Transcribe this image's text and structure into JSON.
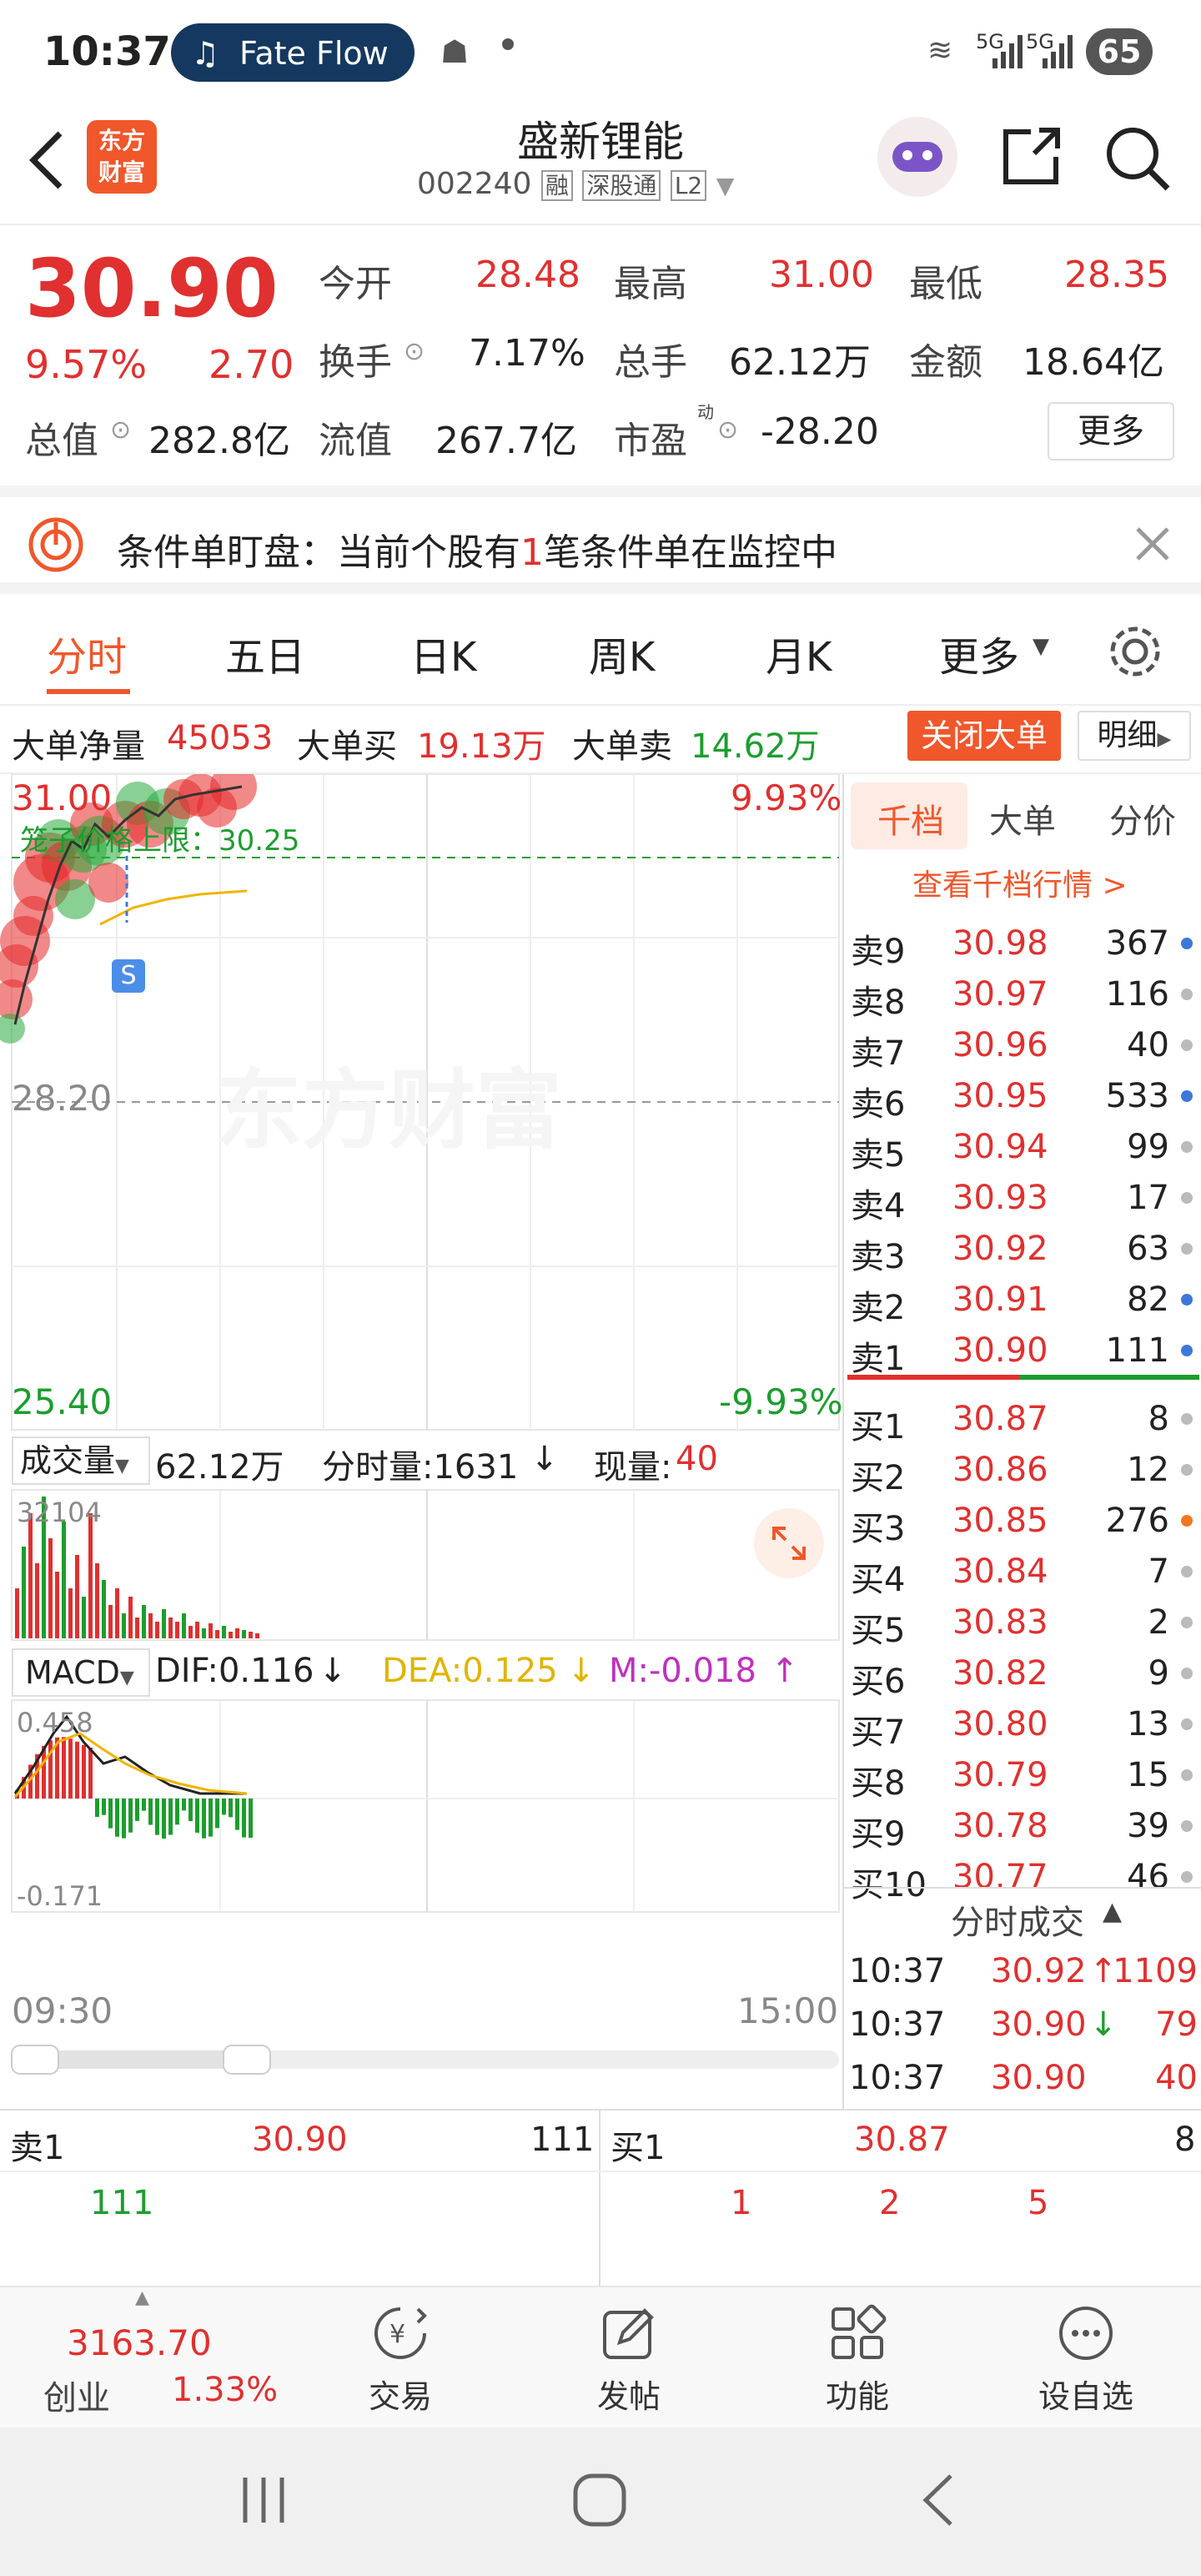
{
  "statusbar": {
    "time": "10:37",
    "pill_label": "Fate Flow",
    "battery": "65",
    "net1": "5G",
    "net2": "5G"
  },
  "header": {
    "logo_line1": "东方",
    "logo_line2": "财富",
    "stock_name": "盛新锂能",
    "stock_code": "002240",
    "tag_rong": "融",
    "tag_sgt": "深股通",
    "tag_l2": "L2"
  },
  "quote": {
    "price": "30.90",
    "pct": "9.57%",
    "change": "2.70",
    "open_label": "今开",
    "open": "28.48",
    "high_label": "最高",
    "high": "31.00",
    "low_label": "最低",
    "low": "28.35",
    "turnover_label": "换手",
    "turnover": "7.17%",
    "volume_label": "总手",
    "volume": "62.12万",
    "amount_label": "金额",
    "amount": "18.64亿",
    "mktcap_label": "总值",
    "mktcap": "282.8亿",
    "float_label": "流值",
    "float": "267.7亿",
    "pe_label": "市盈",
    "pe_sup": "动",
    "pe": "-28.20",
    "more_label": "更多"
  },
  "alert": {
    "text_pre": "条件单盯盘：当前个股有",
    "count": "1",
    "text_post": "笔条件单在监控中"
  },
  "tabs": [
    {
      "label": "分时"
    },
    {
      "label": "五日"
    },
    {
      "label": "日K"
    },
    {
      "label": "周K"
    },
    {
      "label": "月K"
    },
    {
      "label": "更多"
    }
  ],
  "dadan": {
    "net_label": "大单净量",
    "net": "45053",
    "buy_label": "大单买",
    "buy": "19.13万",
    "sell_label": "大单卖",
    "sell": "14.62万",
    "close_btn": "关闭大单",
    "detail_btn": "明细"
  },
  "chart": {
    "high_price": "31.00",
    "high_pct": "9.93%",
    "mid_price": "28.20",
    "low_price": "25.40",
    "low_pct": "-9.93%",
    "cage_label": "笼子价格上限：30.25",
    "watermark": "东方财富",
    "s_marker": "S",
    "vol_label": "成交量",
    "vol_total": "62.12万",
    "vol_min_label": "分时量:1631",
    "vol_now_label": "现量:",
    "vol_now": "40",
    "vol_max": "32104",
    "macd_label": "MACD",
    "dif": "DIF:0.116",
    "dea": "DEA:0.125",
    "m": "M:-0.018",
    "macd_max": "0.458",
    "macd_min": "-0.171",
    "time_start": "09:30",
    "time_end": "15:00"
  },
  "orderbook": {
    "tabs": [
      {
        "label": "千档"
      },
      {
        "label": "大单"
      },
      {
        "label": "分价"
      }
    ],
    "link": "查看千档行情 >",
    "sell": [
      {
        "label": "卖9",
        "price": "30.98",
        "vol": "367",
        "dot": "#3b78d8"
      },
      {
        "label": "卖8",
        "price": "30.97",
        "vol": "116",
        "dot": "#bbbbbb"
      },
      {
        "label": "卖7",
        "price": "30.96",
        "vol": "40",
        "dot": "#bbbbbb"
      },
      {
        "label": "卖6",
        "price": "30.95",
        "vol": "533",
        "dot": "#3b78d8"
      },
      {
        "label": "卖5",
        "price": "30.94",
        "vol": "99",
        "dot": "#bbbbbb"
      },
      {
        "label": "卖4",
        "price": "30.93",
        "vol": "17",
        "dot": "#bbbbbb"
      },
      {
        "label": "卖3",
        "price": "30.92",
        "vol": "63",
        "dot": "#bbbbbb"
      },
      {
        "label": "卖2",
        "price": "30.91",
        "vol": "82",
        "dot": "#3b78d8"
      },
      {
        "label": "卖1",
        "price": "30.90",
        "vol": "111",
        "dot": "#3b78d8"
      }
    ],
    "buy": [
      {
        "label": "买1",
        "price": "30.87",
        "vol": "8",
        "dot": "#bbbbbb"
      },
      {
        "label": "买2",
        "price": "30.86",
        "vol": "12",
        "dot": "#bbbbbb"
      },
      {
        "label": "买3",
        "price": "30.85",
        "vol": "276",
        "dot": "#f07820"
      },
      {
        "label": "买4",
        "price": "30.84",
        "vol": "7",
        "dot": "#bbbbbb"
      },
      {
        "label": "买5",
        "price": "30.83",
        "vol": "2",
        "dot": "#bbbbbb"
      },
      {
        "label": "买6",
        "price": "30.82",
        "vol": "9",
        "dot": "#bbbbbb"
      },
      {
        "label": "买7",
        "price": "30.80",
        "vol": "13",
        "dot": "#bbbbbb"
      },
      {
        "label": "买8",
        "price": "30.79",
        "vol": "15",
        "dot": "#bbbbbb"
      },
      {
        "label": "买9",
        "price": "30.78",
        "vol": "39",
        "dot": "#bbbbbb"
      },
      {
        "label": "买10",
        "price": "30.77",
        "vol": "46",
        "dot": "#bbbbbb"
      }
    ],
    "ticks_title": "分时成交",
    "ticks": [
      {
        "time": "10:37",
        "price": "30.92",
        "arrow": "↑",
        "vol": "1109"
      },
      {
        "time": "10:37",
        "price": "30.90",
        "arrow": "↓",
        "vol": "79"
      },
      {
        "time": "10:37",
        "price": "30.90",
        "arrow": "",
        "vol": "40"
      }
    ]
  },
  "bottom": {
    "sell_label": "卖1",
    "sell_price": "30.90",
    "sell_vol": "111",
    "buy_label": "买1",
    "buy_price": "30.87",
    "buy_vol": "8",
    "sell_queue": [
      "111"
    ],
    "buy_queue": [
      "1",
      "2",
      "5"
    ]
  },
  "bottomnav": {
    "index_value": "3163.70",
    "index_name": "创业",
    "index_pct": "1.33%",
    "items": [
      {
        "label": "交易"
      },
      {
        "label": "发帖"
      },
      {
        "label": "功能"
      },
      {
        "label": "设自选"
      }
    ]
  }
}
